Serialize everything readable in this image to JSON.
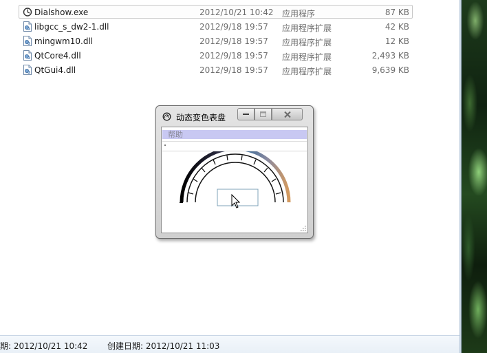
{
  "files": [
    {
      "name": "Dialshow.exe",
      "date": "2012/10/21 10:42",
      "type": "应用程序",
      "size": "87 KB",
      "icon": "exe-icon",
      "selected": true
    },
    {
      "name": "libgcc_s_dw2-1.dll",
      "date": "2012/9/18 19:57",
      "type": "应用程序扩展",
      "size": "42 KB",
      "icon": "dll-icon",
      "selected": false
    },
    {
      "name": "mingwm10.dll",
      "date": "2012/9/18 19:57",
      "type": "应用程序扩展",
      "size": "12 KB",
      "icon": "dll-icon",
      "selected": false
    },
    {
      "name": "QtCore4.dll",
      "date": "2012/9/18 19:57",
      "type": "应用程序扩展",
      "size": "2,493 KB",
      "icon": "dll-icon",
      "selected": false
    },
    {
      "name": "QtGui4.dll",
      "date": "2012/9/18 19:57",
      "type": "应用程序扩展",
      "size": "9,639 KB",
      "icon": "dll-icon",
      "selected": false
    }
  ],
  "status": {
    "modified": "期: 2012/10/21 10:42",
    "created": "创建日期: 2012/10/21 11:03"
  },
  "dialog": {
    "title": "动态变色表盘",
    "menu_help": "帮助",
    "title_icon": "app-dial-icon",
    "minimize_icon": "minimize-icon",
    "maximize_icon": "maximize-icon",
    "close_icon": "close-icon"
  },
  "colors": {
    "menu_highlight": "#c8c8f2",
    "dial_gradient_start": "#000000",
    "dial_gradient_mid": "#3a6a96",
    "dial_gradient_end": "#d49a5e"
  }
}
